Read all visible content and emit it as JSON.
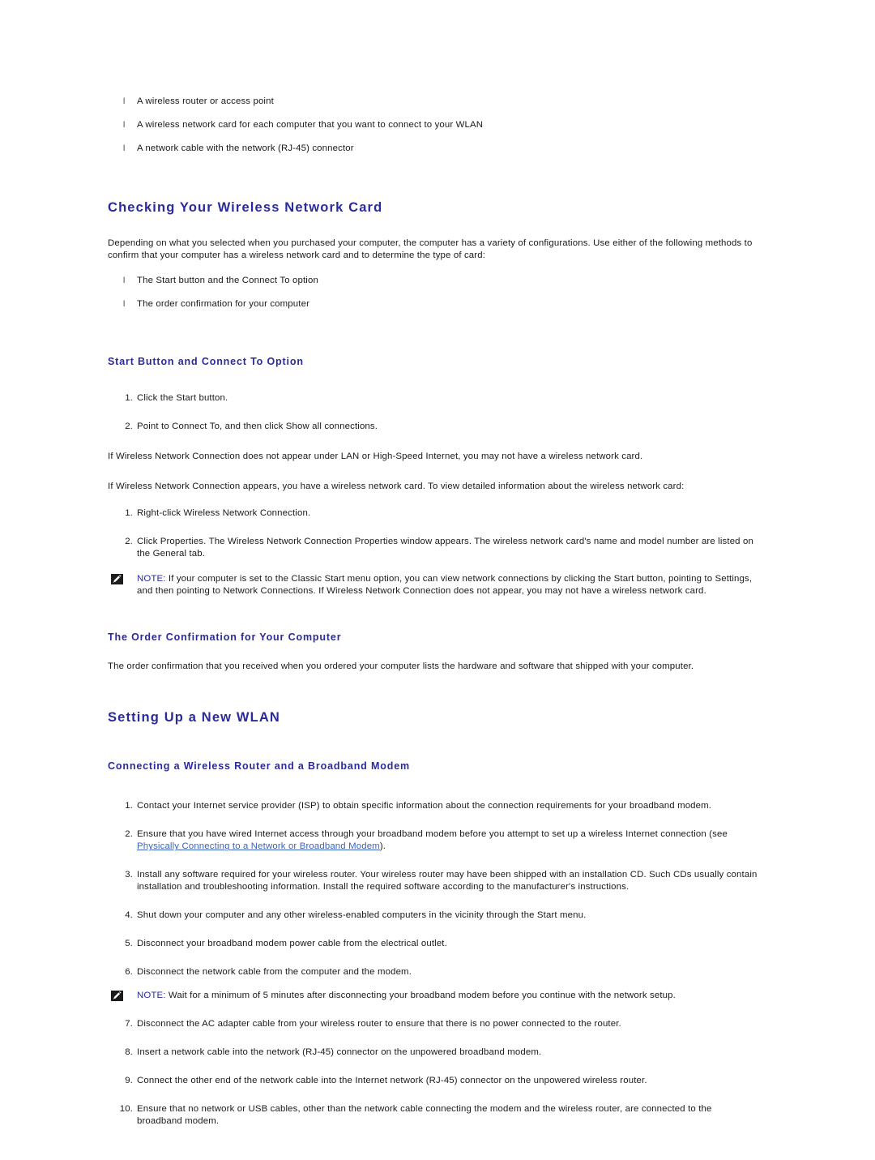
{
  "colors": {
    "heading": "#2a2a9c",
    "link": "#3a62c4",
    "body": "#1a1a1a",
    "note_icon_bg": "#1c1c1c",
    "page_bg": "#ffffff"
  },
  "requirements_list": {
    "bullet_glyph": "l",
    "items": [
      "A wireless router or access point",
      "A wireless network card for each computer that you want to connect to your WLAN",
      "A network cable with the network (RJ-45) connector"
    ]
  },
  "checking_section": {
    "title": "Checking Your Wireless Network Card",
    "intro": "Depending on what you selected when you purchased your computer, the computer has a variety of configurations. Use either of the following methods to confirm that your computer has a wireless network card and to determine the type of card:",
    "methods": [
      "The Start button and the Connect To option",
      "The order confirmation for your computer"
    ]
  },
  "start_button_section": {
    "title": "Start Button and Connect To Option",
    "steps_1": [
      "Click the Start button.",
      "Point to Connect To, and then click Show all connections."
    ],
    "para_no_card": "If Wireless Network Connection does not appear under LAN or High-Speed Internet, you may not have a wireless network card.",
    "para_has_card": "If Wireless Network Connection appears, you have a wireless network card. To view detailed information about the wireless network card:",
    "steps_2": [
      "Right-click Wireless Network Connection.",
      "Click Properties. The Wireless Network Connection Properties window appears. The wireless network card's name and model number are listed on the General tab."
    ],
    "note": {
      "label": "NOTE:",
      "text": " If your computer is set to the Classic Start menu option, you can view network connections by clicking the Start button, pointing to Settings, and then pointing to Network Connections. If Wireless Network Connection does not appear, you may not have a wireless network card."
    }
  },
  "order_confirmation_section": {
    "title": "The Order Confirmation for Your Computer",
    "text": "The order confirmation that you received when you ordered your computer lists the hardware and software that shipped with your computer."
  },
  "setting_up_section": {
    "title": "Setting Up a New WLAN",
    "subsection_title": "Connecting a Wireless Router and a Broadband Modem",
    "step_1": "Contact your Internet service provider (ISP) to obtain specific information about the connection requirements for your broadband modem.",
    "step_2_pre": "Ensure that you have wired Internet access through your broadband modem before you attempt to set up a wireless Internet connection (see ",
    "step_2_link": "Physically Connecting to a Network or Broadband Modem",
    "step_2_post": ").",
    "step_3": "Install any software required for your wireless router. Your wireless router may have been shipped with an installation CD. Such CDs usually contain installation and troubleshooting information. Install the required software according to the manufacturer's instructions.",
    "step_4": "Shut down your computer and any other wireless-enabled computers in the vicinity through the Start menu.",
    "step_5": "Disconnect your broadband modem power cable from the electrical outlet.",
    "step_6": "Disconnect the network cable from the computer and the modem.",
    "note": {
      "label": "NOTE:",
      "text": " Wait for a minimum of 5 minutes after disconnecting your broadband modem before you continue with the network setup."
    },
    "step_7": "Disconnect the AC adapter cable from your wireless router to ensure that there is no power connected to the router.",
    "step_8": "Insert a network cable into the network (RJ-45) connector on the unpowered broadband modem.",
    "step_9": "Connect the other end of the network cable into the Internet network (RJ-45) connector on the unpowered wireless router.",
    "step_10": "Ensure that no network or USB cables, other than the network cable connecting the modem and the wireless router, are connected to the broadband modem.",
    "numbers": [
      "1.",
      "2.",
      "3.",
      "4.",
      "5.",
      "6.",
      "7.",
      "8.",
      "9.",
      "10."
    ]
  },
  "icons": {
    "note": "pencil-note-icon"
  }
}
